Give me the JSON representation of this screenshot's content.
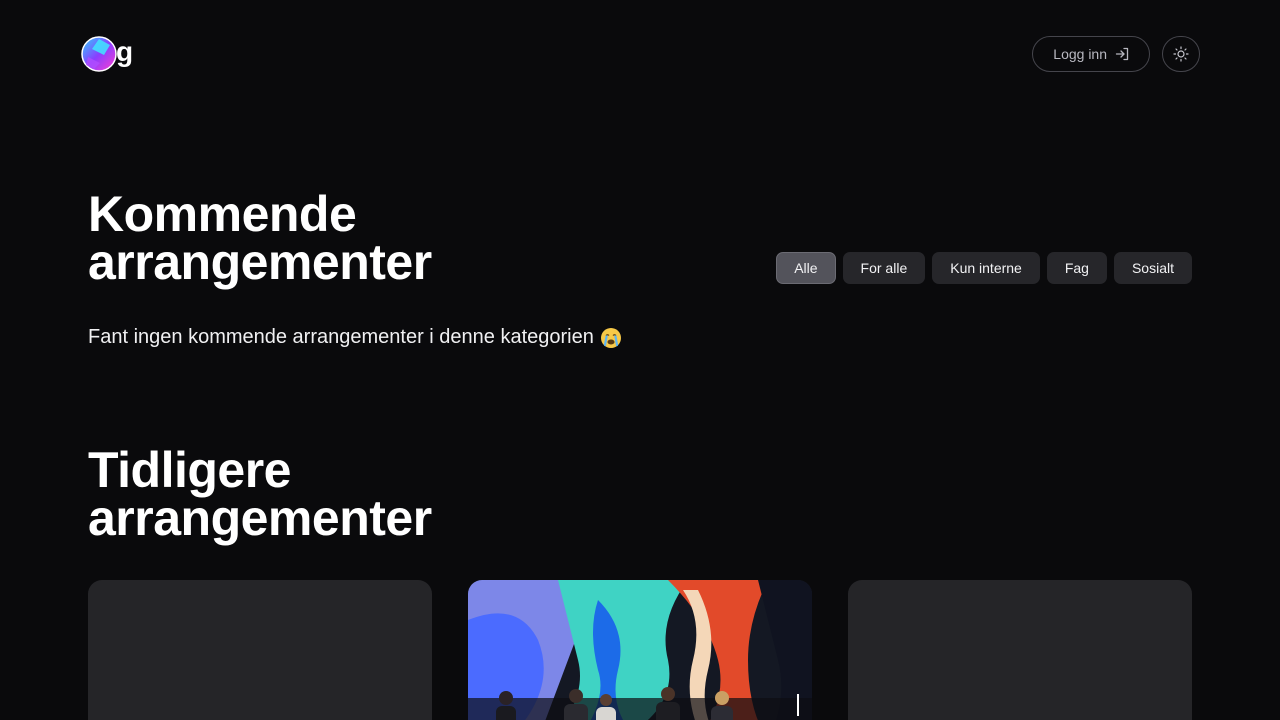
{
  "header": {
    "logo_letter": "g",
    "login_label": "Logg inn",
    "icons": {
      "login": "login-arrow-icon",
      "theme": "sun-icon",
      "logo": "logo-icon"
    }
  },
  "upcoming": {
    "title": "Kommende arrangementer",
    "filters": [
      {
        "label": "Alle",
        "active": true
      },
      {
        "label": "For alle",
        "active": false
      },
      {
        "label": "Kun interne",
        "active": false
      },
      {
        "label": "Fag",
        "active": false
      },
      {
        "label": "Sosialt",
        "active": false
      }
    ],
    "empty_message": "Fant ingen kommende arrangementer i denne kategorien",
    "empty_emoji_icon": "crying-face-icon"
  },
  "past": {
    "title": "Tidligere arrangementer"
  },
  "colors": {
    "background": "#0a0a0c",
    "chip": "#26262a",
    "chip_active": "#53535b",
    "card": "#252528"
  }
}
